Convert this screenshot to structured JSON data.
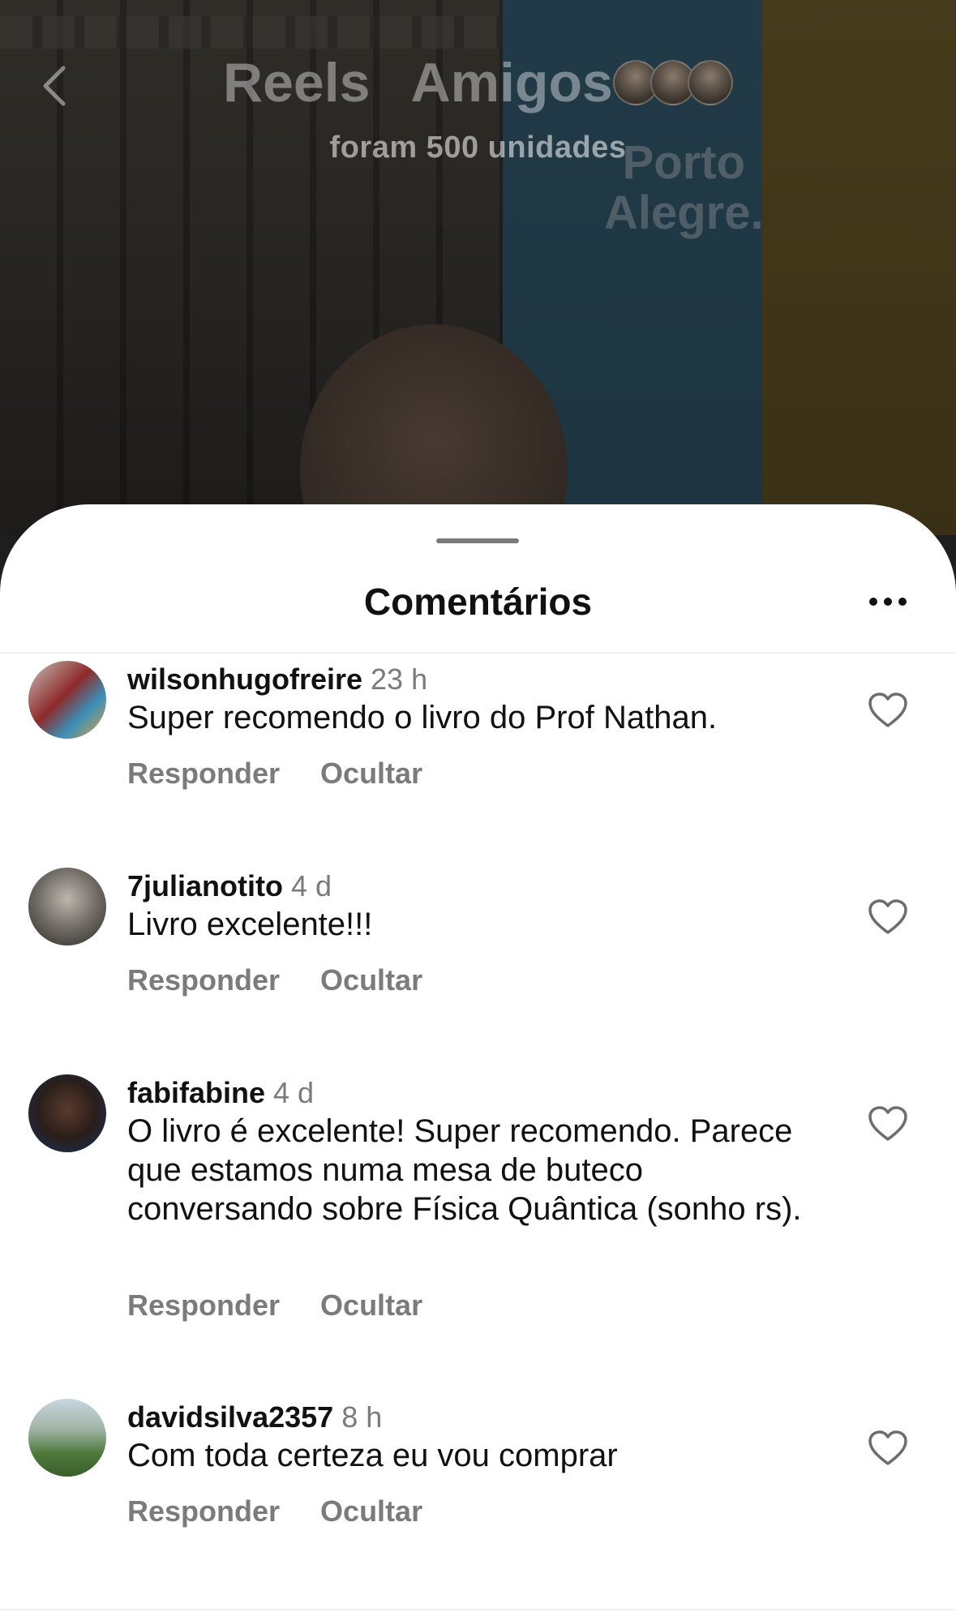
{
  "header": {
    "tabs": [
      {
        "label": "Reels"
      },
      {
        "label": "Amigos"
      }
    ],
    "caption": "foram 500 unidades",
    "banner_text": "Porto\nAlegre."
  },
  "sheet": {
    "title": "Comentários"
  },
  "comments": [
    {
      "username": "wilsonhugofreire",
      "time": "23 h",
      "text": "Super recomendo o livro do Prof Nathan.",
      "reply": "Responder",
      "hide": "Ocultar"
    },
    {
      "username": "7julianotito",
      "time": "4 d",
      "text": "Livro excelente!!!",
      "reply": "Responder",
      "hide": "Ocultar"
    },
    {
      "username": "fabifabine",
      "time": "4 d",
      "text": "O livro é excelente! Super recomendo. Parece que estamos numa mesa de buteco conversando sobre Física Quântica (sonho rs).",
      "reply": "Responder",
      "hide": "Ocultar"
    },
    {
      "username": "davidsilva2357",
      "time": "8 h",
      "text": "Com toda certeza eu vou comprar",
      "reply": "Responder",
      "hide": "Ocultar"
    }
  ],
  "icons": {
    "back": "chevron-left-icon",
    "more": "more-horizontal-icon",
    "like": "heart-icon"
  },
  "colors": {
    "text": "#111111",
    "secondary": "#7b7b7b",
    "sheet_bg": "#ffffff"
  }
}
